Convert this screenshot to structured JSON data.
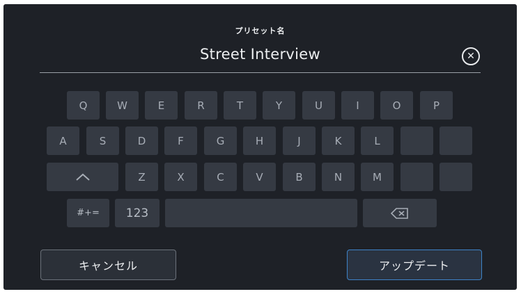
{
  "dialog": {
    "title": "プリセット名",
    "preset_name": "Street Interview"
  },
  "icons": {
    "clear": "close-circle-icon",
    "backspace": "backspace-icon",
    "shift": "shift-caret-icon"
  },
  "keyboard": {
    "row1": [
      "Q",
      "W",
      "E",
      "R",
      "T",
      "Y",
      "U",
      "I",
      "O",
      "P"
    ],
    "row2": [
      "A",
      "S",
      "D",
      "F",
      "G",
      "H",
      "J",
      "K",
      "L",
      "",
      ""
    ],
    "row3": [
      "",
      "Z",
      "X",
      "C",
      "V",
      "B",
      "N",
      "M",
      "",
      ""
    ],
    "symbols_label": "#+=",
    "numbers_label": "123"
  },
  "buttons": {
    "cancel": "キャンセル",
    "update": "アップデート"
  },
  "colors": {
    "background": "#1e2127",
    "key": "#353a43",
    "accent": "#3e84c9"
  }
}
